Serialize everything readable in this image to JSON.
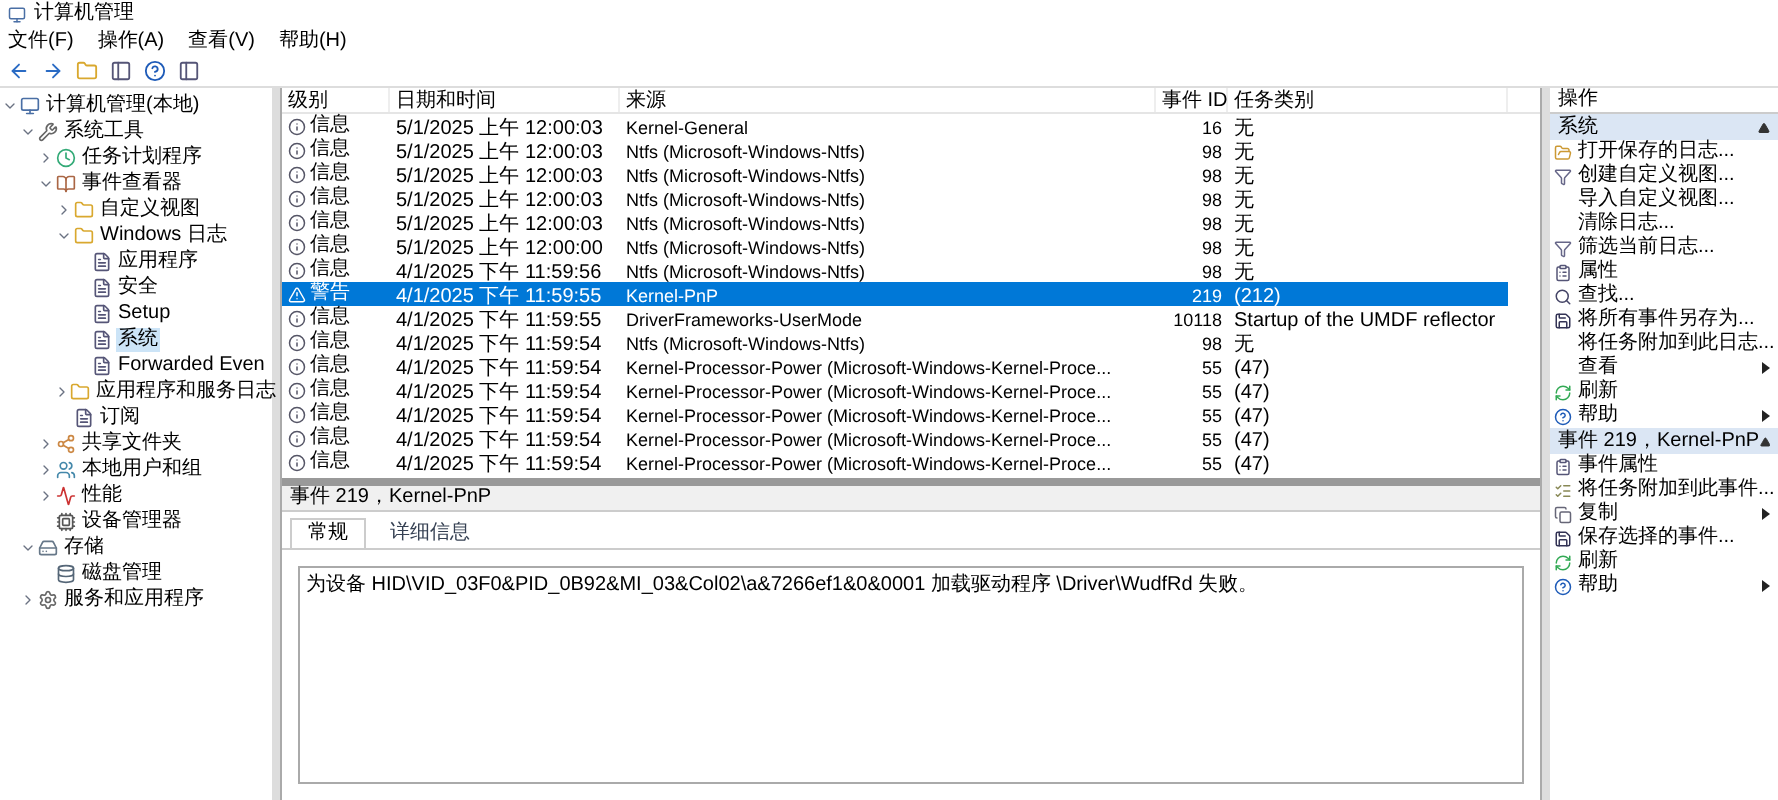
{
  "window": {
    "title": "计算机管理"
  },
  "menu": [
    {
      "label": "文件(F)"
    },
    {
      "label": "操作(A)"
    },
    {
      "label": "查看(V)"
    },
    {
      "label": "帮助(H)"
    }
  ],
  "tree": [
    {
      "label": "计算机管理(本地)",
      "kind": "computer",
      "selected": false,
      "expanded": true,
      "children": [
        {
          "label": "系统工具",
          "kind": "tools",
          "selected": false,
          "expanded": true,
          "children": [
            {
              "label": "任务计划程序",
              "kind": "clock",
              "selected": false,
              "expanded": false
            },
            {
              "label": "事件查看器",
              "kind": "viewer",
              "selected": false,
              "expanded": true,
              "children": [
                {
                  "label": "自定义视图",
                  "kind": "folder",
                  "selected": false,
                  "expanded": false
                },
                {
                  "label": "Windows 日志",
                  "kind": "folder",
                  "selected": false,
                  "expanded": true,
                  "children": [
                    {
                      "label": "应用程序",
                      "kind": "log",
                      "selected": false
                    },
                    {
                      "label": "安全",
                      "kind": "log",
                      "selected": false
                    },
                    {
                      "label": "Setup",
                      "kind": "log",
                      "selected": false
                    },
                    {
                      "label": "系统",
                      "kind": "log",
                      "selected": true
                    },
                    {
                      "label": "Forwarded Even",
                      "kind": "log",
                      "selected": false
                    }
                  ]
                },
                {
                  "label": "应用程序和服务日志",
                  "kind": "folder",
                  "selected": false,
                  "expanded": false
                },
                {
                  "label": "订阅",
                  "kind": "log",
                  "selected": false
                }
              ]
            },
            {
              "label": "共享文件夹",
              "kind": "share",
              "selected": false,
              "expanded": false
            },
            {
              "label": "本地用户和组",
              "kind": "users",
              "selected": false,
              "expanded": false
            },
            {
              "label": "性能",
              "kind": "perf",
              "selected": false,
              "expanded": false
            },
            {
              "label": "设备管理器",
              "kind": "device",
              "selected": false
            }
          ]
        },
        {
          "label": "存储",
          "kind": "storage",
          "selected": false,
          "expanded": true,
          "children": [
            {
              "label": "磁盘管理",
              "kind": "disk",
              "selected": false
            }
          ]
        },
        {
          "label": "服务和应用程序",
          "kind": "services",
          "selected": false,
          "expanded": false
        }
      ]
    }
  ],
  "table": {
    "columns": [
      "级别",
      "日期和时间",
      "来源",
      "事件 ID",
      "任务类别"
    ],
    "rows": [
      {
        "kind": "info",
        "level": "信息",
        "date": "5/1/2025 上午 12:00:03",
        "source": "Kernel-General",
        "id": "16",
        "task": "无",
        "selected": false
      },
      {
        "kind": "info",
        "level": "信息",
        "date": "5/1/2025 上午 12:00:03",
        "source": "Ntfs (Microsoft-Windows-Ntfs)",
        "id": "98",
        "task": "无",
        "selected": false
      },
      {
        "kind": "info",
        "level": "信息",
        "date": "5/1/2025 上午 12:00:03",
        "source": "Ntfs (Microsoft-Windows-Ntfs)",
        "id": "98",
        "task": "无",
        "selected": false
      },
      {
        "kind": "info",
        "level": "信息",
        "date": "5/1/2025 上午 12:00:03",
        "source": "Ntfs (Microsoft-Windows-Ntfs)",
        "id": "98",
        "task": "无",
        "selected": false
      },
      {
        "kind": "info",
        "level": "信息",
        "date": "5/1/2025 上午 12:00:03",
        "source": "Ntfs (Microsoft-Windows-Ntfs)",
        "id": "98",
        "task": "无",
        "selected": false
      },
      {
        "kind": "info",
        "level": "信息",
        "date": "5/1/2025 上午 12:00:00",
        "source": "Ntfs (Microsoft-Windows-Ntfs)",
        "id": "98",
        "task": "无",
        "selected": false
      },
      {
        "kind": "info",
        "level": "信息",
        "date": "4/1/2025 下午 11:59:56",
        "source": "Ntfs (Microsoft-Windows-Ntfs)",
        "id": "98",
        "task": "无",
        "selected": false
      },
      {
        "kind": "warning",
        "level": "警告",
        "date": "4/1/2025 下午 11:59:55",
        "source": "Kernel-PnP",
        "id": "219",
        "task": "(212)",
        "selected": true
      },
      {
        "kind": "info",
        "level": "信息",
        "date": "4/1/2025 下午 11:59:55",
        "source": "DriverFrameworks-UserMode",
        "id": "10118",
        "task": "Startup of the UMDF reflector",
        "selected": false
      },
      {
        "kind": "info",
        "level": "信息",
        "date": "4/1/2025 下午 11:59:54",
        "source": "Ntfs (Microsoft-Windows-Ntfs)",
        "id": "98",
        "task": "无",
        "selected": false
      },
      {
        "kind": "info",
        "level": "信息",
        "date": "4/1/2025 下午 11:59:54",
        "source": "Kernel-Processor-Power (Microsoft-Windows-Kernel-Proce...",
        "id": "55",
        "task": "(47)",
        "selected": false
      },
      {
        "kind": "info",
        "level": "信息",
        "date": "4/1/2025 下午 11:59:54",
        "source": "Kernel-Processor-Power (Microsoft-Windows-Kernel-Proce...",
        "id": "55",
        "task": "(47)",
        "selected": false
      },
      {
        "kind": "info",
        "level": "信息",
        "date": "4/1/2025 下午 11:59:54",
        "source": "Kernel-Processor-Power (Microsoft-Windows-Kernel-Proce...",
        "id": "55",
        "task": "(47)",
        "selected": false
      },
      {
        "kind": "info",
        "level": "信息",
        "date": "4/1/2025 下午 11:59:54",
        "source": "Kernel-Processor-Power (Microsoft-Windows-Kernel-Proce...",
        "id": "55",
        "task": "(47)",
        "selected": false
      },
      {
        "kind": "info",
        "level": "信息",
        "date": "4/1/2025 下午 11:59:54",
        "source": "Kernel-Processor-Power (Microsoft-Windows-Kernel-Proce...",
        "id": "55",
        "task": "(47)",
        "selected": false
      }
    ]
  },
  "detail": {
    "title": "事件 219，Kernel-PnP",
    "tabs": [
      {
        "label": "常规",
        "selected": true
      },
      {
        "label": "详细信息",
        "selected": false
      }
    ],
    "message": "为设备 HID\\VID_03F0&PID_0B92&MI_03&Col02\\a&7266ef1&0&0001 加载驱动程序 \\Driver\\WudfRd 失败。"
  },
  "actions": {
    "title": "操作",
    "sections": [
      {
        "title": "系统",
        "expanded": true,
        "items": [
          {
            "label": "打开保存的日志...",
            "kind": "open",
            "submenu": false
          },
          {
            "label": "创建自定义视图...",
            "kind": "filter",
            "submenu": false
          },
          {
            "label": "导入自定义视图...",
            "kind": "none",
            "submenu": false
          },
          {
            "label": "清除日志...",
            "kind": "none",
            "submenu": false
          },
          {
            "label": "筛选当前日志...",
            "kind": "filter",
            "submenu": false
          },
          {
            "label": "属性",
            "kind": "props",
            "submenu": false
          },
          {
            "label": "查找...",
            "kind": "find",
            "submenu": false
          },
          {
            "label": "将所有事件另存为...",
            "kind": "save",
            "submenu": false
          },
          {
            "label": "将任务附加到此日志...",
            "kind": "none",
            "submenu": false
          },
          {
            "label": "查看",
            "kind": "none",
            "submenu": true
          },
          {
            "label": "刷新",
            "kind": "refresh",
            "submenu": false
          },
          {
            "label": "帮助",
            "kind": "help",
            "submenu": true
          }
        ]
      },
      {
        "title": "事件 219，Kernel-PnP",
        "expanded": true,
        "items": [
          {
            "label": "事件属性",
            "kind": "props",
            "submenu": false
          },
          {
            "label": "将任务附加到此事件...",
            "kind": "task",
            "submenu": false
          },
          {
            "label": "复制",
            "kind": "copy",
            "submenu": true
          },
          {
            "label": "保存选择的事件...",
            "kind": "save",
            "submenu": false
          },
          {
            "label": "刷新",
            "kind": "refresh",
            "submenu": false
          },
          {
            "label": "帮助",
            "kind": "help",
            "submenu": true
          }
        ]
      }
    ]
  }
}
